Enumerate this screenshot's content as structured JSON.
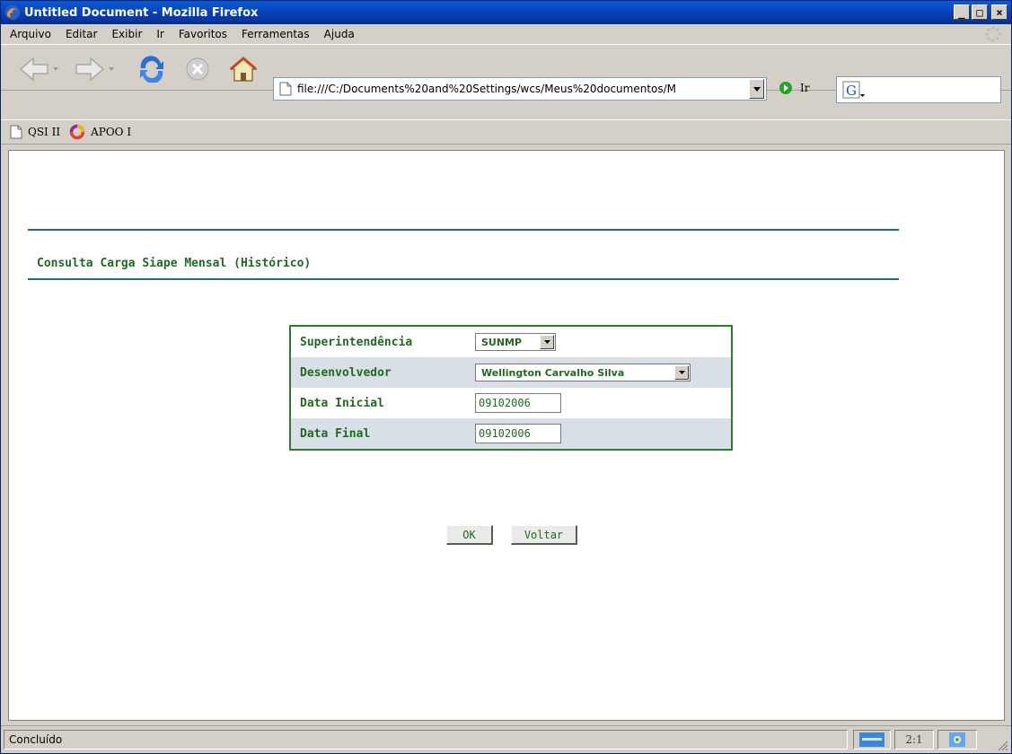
{
  "window": {
    "title": "Untitled Document - Mozilla Firefox",
    "minimize_glyph": "_",
    "maximize_glyph": "□",
    "close_glyph": "×"
  },
  "menubar": {
    "items": [
      "Arquivo",
      "Editar",
      "Exibir",
      "Ir",
      "Favoritos",
      "Ferramentas",
      "Ajuda"
    ]
  },
  "navbar": {
    "url": "file:///C:/Documents%20and%20Settings/wcs/Meus%20documentos/M",
    "go_label": "Ir",
    "search_value": ""
  },
  "bookmarks": {
    "items": [
      "QSI II",
      "APOO I"
    ]
  },
  "page": {
    "title": "Consulta Carga Siape Mensal (Histórico)",
    "form": {
      "superintendencia_label": "Superintendência",
      "superintendencia_value": "SUNMP",
      "desenvolvedor_label": "Desenvolvedor",
      "desenvolvedor_value": "Wellington Carvalho Silva",
      "data_inicial_label": "Data Inicial",
      "data_inicial_value": "09102006",
      "data_final_label": "Data Final",
      "data_final_value": "09102006"
    },
    "buttons": {
      "ok_label": "OK",
      "voltar_label": "Voltar"
    }
  },
  "statusbar": {
    "text": "Concluído",
    "zoom": "2:1"
  },
  "colors": {
    "accent_green": "#1f6b1f",
    "rule_teal": "#1d6b7f",
    "titlebar_blue": "#0842b8"
  }
}
